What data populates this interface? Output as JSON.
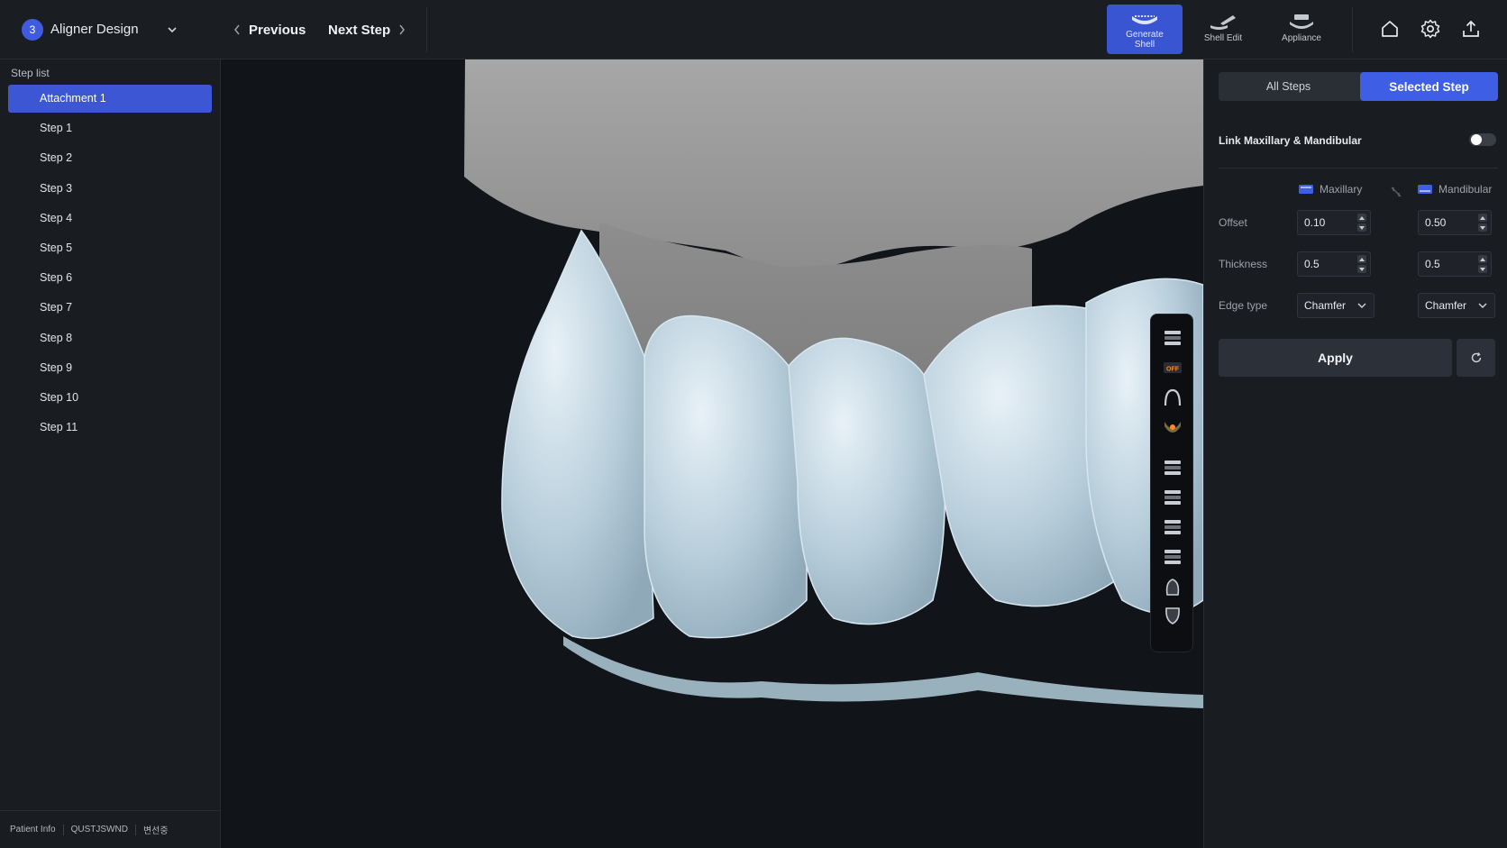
{
  "header": {
    "stage_number": "3",
    "stage_title": "Aligner Design",
    "prev_label": "Previous",
    "next_label": "Next Step",
    "tools": [
      {
        "label": "Generate Shell",
        "icon": "generate-shell-icon",
        "active": true
      },
      {
        "label": "Shell Edit",
        "icon": "shell-edit-icon",
        "active": false
      },
      {
        "label": "Appliance",
        "icon": "appliance-icon",
        "active": false
      }
    ],
    "actions": [
      "home-icon",
      "gear-icon",
      "export-icon"
    ]
  },
  "sidebar": {
    "title": "Step list",
    "steps": [
      "Attachment 1",
      "Step 1",
      "Step 2",
      "Step 3",
      "Step 4",
      "Step 5",
      "Step 6",
      "Step 7",
      "Step 8",
      "Step 9",
      "Step 10",
      "Step 11"
    ],
    "selected_index": 0,
    "footer": {
      "patient_info_label": "Patient Info",
      "patient_id": "QUSTJSWND",
      "patient_name": "변선중"
    }
  },
  "viewport": {
    "toolstrip_icons": [
      "upper-arch-icon",
      "gingiva-off-icon",
      "arch-outline-icon",
      "lower-off-icon",
      "front-view-icon",
      "back-view-icon",
      "left-view-icon",
      "right-view-icon",
      "top-view-icon",
      "bottom-view-icon"
    ],
    "toolstrip_off_label": "OFF"
  },
  "panel": {
    "tabs": {
      "all": "All Steps",
      "selected": "Selected Step"
    },
    "active_tab": "selected",
    "link_label": "Link Maxillary & Mandibular",
    "link_enabled": false,
    "columns": {
      "maxillary": "Maxillary",
      "mandibular": "Mandibular"
    },
    "rows": {
      "offset": {
        "label": "Offset",
        "maxillary": "0.10",
        "mandibular": "0.50"
      },
      "thickness": {
        "label": "Thickness",
        "maxillary": "0.5",
        "mandibular": "0.5"
      },
      "edge_type": {
        "label": "Edge type",
        "maxillary": "Chamfer",
        "mandibular": "Chamfer"
      }
    },
    "apply_label": "Apply"
  },
  "colors": {
    "accent": "#3e5ee6",
    "background": "#111418",
    "panel": "#191c21",
    "tooth_shell": "#b9cfdc",
    "gum_model": "#9c9c9c"
  }
}
